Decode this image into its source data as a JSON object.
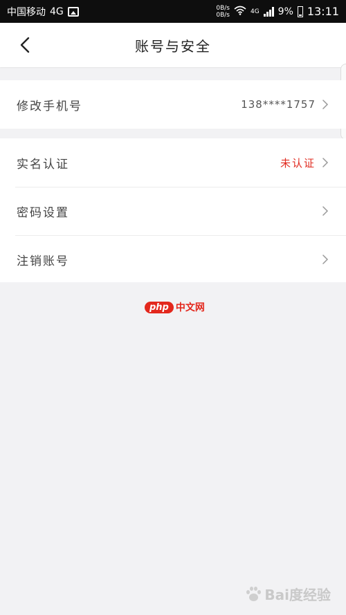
{
  "status_bar": {
    "carrier": "中国移动",
    "network": "4G",
    "speed_up": "0B/s",
    "speed_down": "0B/s",
    "mobile_network": "4G",
    "battery": "9%",
    "time": "13:11"
  },
  "nav": {
    "title": "账号与安全"
  },
  "groups": {
    "phone": {
      "label": "修改手机号",
      "value": "138****1757"
    },
    "realname": {
      "label": "实名认证",
      "value": "未认证",
      "value_color": "#e02b20"
    },
    "password": {
      "label": "密码设置"
    },
    "cancel": {
      "label": "注销账号"
    }
  },
  "watermark": {
    "php": "php",
    "site": "中文网",
    "baidu": "Bai度经验"
  },
  "colors": {
    "accent_red": "#e02b20",
    "background": "#f2f2f4"
  }
}
